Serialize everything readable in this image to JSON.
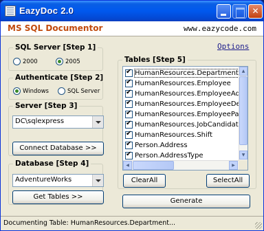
{
  "window": {
    "title": "EazyDoc 2.0"
  },
  "header": {
    "title": "MS SQL Documentor",
    "url": "www.eazycode.com"
  },
  "options_link": "Options",
  "sql_server": {
    "label": "SQL Server  [Step 1]",
    "options": [
      {
        "label": "2000",
        "selected": false
      },
      {
        "label": "2005",
        "selected": true
      }
    ]
  },
  "authenticate": {
    "label": "Authenticate  [Step 2]",
    "options": [
      {
        "label": "Windows",
        "selected": true
      },
      {
        "label": "SQL Server",
        "selected": false
      }
    ]
  },
  "server": {
    "label": "Server  [Step 3]",
    "value": "DC\\sqlexpress",
    "connect_button": "Connect Database >>"
  },
  "database": {
    "label": "Database  [Step 4]",
    "value": "AdventureWorks",
    "get_tables_button": "Get Tables >>"
  },
  "tables": {
    "label": "Tables  [Step 5]",
    "items": [
      {
        "label": "HumanResources.Department",
        "checked": true,
        "focused": true
      },
      {
        "label": "HumanResources.Employee",
        "checked": true
      },
      {
        "label": "HumanResources.EmployeeAdd",
        "checked": true
      },
      {
        "label": "HumanResources.EmployeeDep",
        "checked": true
      },
      {
        "label": "HumanResources.EmployeePay",
        "checked": true
      },
      {
        "label": "HumanResources.JobCandidate",
        "checked": true
      },
      {
        "label": "HumanResources.Shift",
        "checked": true
      },
      {
        "label": "Person.Address",
        "checked": true
      },
      {
        "label": "Person.AddressType",
        "checked": true
      }
    ],
    "clear_all_button": "ClearAll",
    "select_all_button": "SelectAll"
  },
  "generate_button": "Generate",
  "status": "Documenting Table: HumanResources.Department..."
}
